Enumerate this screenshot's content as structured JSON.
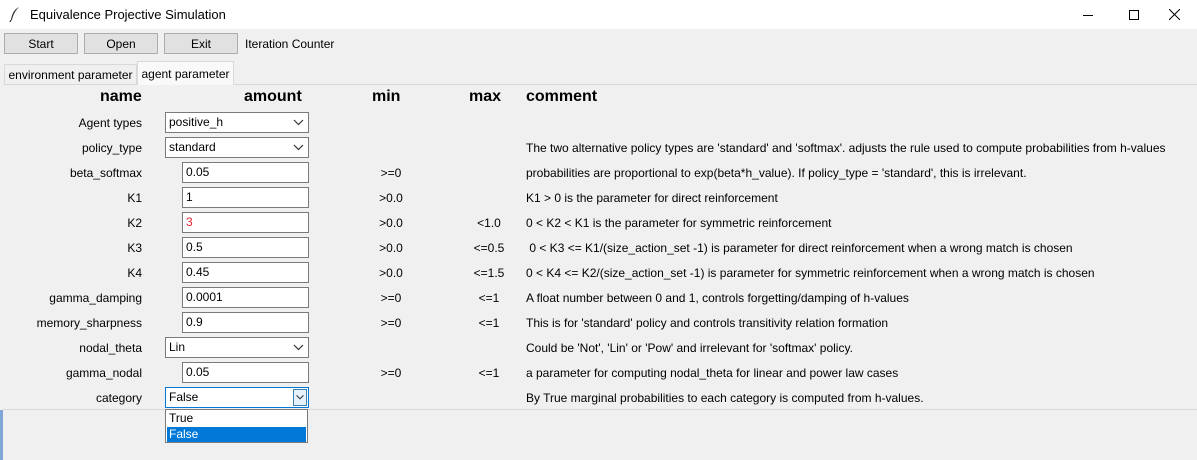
{
  "window": {
    "title": "Equivalence Projective Simulation",
    "icon": "feather-icon",
    "controls": [
      "minimize-icon",
      "maximize-icon",
      "close-icon"
    ]
  },
  "toolbar": {
    "start": "Start",
    "open": "Open",
    "exit": "Exit",
    "iteration_counter": "Iteration Counter"
  },
  "tabs": [
    {
      "label": "environment parameter",
      "active": false
    },
    {
      "label": "agent parameter",
      "active": true
    }
  ],
  "headers": {
    "name": "name",
    "amount": "amount",
    "min": "min",
    "max": "max",
    "comment": "comment"
  },
  "rows": [
    {
      "name": "Agent types",
      "kind": "combo",
      "value": "positive_h",
      "min": "",
      "max": "",
      "comment": ""
    },
    {
      "name": "policy_type",
      "kind": "combo",
      "value": "standard",
      "min": "",
      "max": "",
      "comment": "The two alternative policy types are 'standard' and 'softmax'. adjusts the rule used to compute probabilities from h-values"
    },
    {
      "name": "beta_softmax",
      "kind": "entry",
      "value": "0.05",
      "min": ">=0",
      "max": "",
      "comment": "probabilities are proportional to exp(beta*h_value). If policy_type = 'standard', this is irrelevant."
    },
    {
      "name": "K1",
      "kind": "entry",
      "value": "1",
      "min": ">0.0",
      "max": "",
      "comment": "K1 > 0 is the parameter for direct reinforcement"
    },
    {
      "name": "K2",
      "kind": "entry",
      "value": "3",
      "min": ">0.0",
      "max": "<1.0",
      "comment": "0 < K2 < K1 is the parameter for symmetric reinforcement"
    },
    {
      "name": "K3",
      "kind": "entry",
      "value": "0.5",
      "min": ">0.0",
      "max": "<=0.5",
      "comment": " 0 < K3 <= K1/(size_action_set -1) is parameter for direct reinforcement when a wrong match is chosen"
    },
    {
      "name": "K4",
      "kind": "entry",
      "value": "0.45",
      "min": ">0.0",
      "max": "<=1.5",
      "comment": "0 < K4 <= K2/(size_action_set -1) is parameter for symmetric reinforcement when a wrong match is chosen"
    },
    {
      "name": "gamma_damping",
      "kind": "entry",
      "value": "0.0001",
      "min": ">=0",
      "max": "<=1",
      "comment": "A float number between 0 and 1, controls forgetting/damping of h-values"
    },
    {
      "name": "memory_sharpness",
      "kind": "entry",
      "value": "0.9",
      "min": ">=0",
      "max": "<=1",
      "comment": "This is for 'standard' policy and controls transitivity relation formation"
    },
    {
      "name": "nodal_theta",
      "kind": "combo",
      "value": "Lin",
      "min": "",
      "max": "",
      "comment": "Could be 'Not', 'Lin' or 'Pow' and irrelevant for 'softmax' policy."
    },
    {
      "name": "gamma_nodal",
      "kind": "entry",
      "value": "0.05",
      "min": ">=0",
      "max": "<=1",
      "comment": "a parameter for computing nodal_theta for linear and power law cases"
    },
    {
      "name": "category",
      "kind": "combo",
      "value": "False",
      "min": "",
      "max": "",
      "comment": "By True marginal probabilities to each category is computed from h-values."
    }
  ],
  "category_dropdown": {
    "options": [
      "True",
      "False"
    ],
    "selected": "False"
  },
  "colors": {
    "invalid_value": "#e0252b",
    "selection": "#0078d7"
  }
}
